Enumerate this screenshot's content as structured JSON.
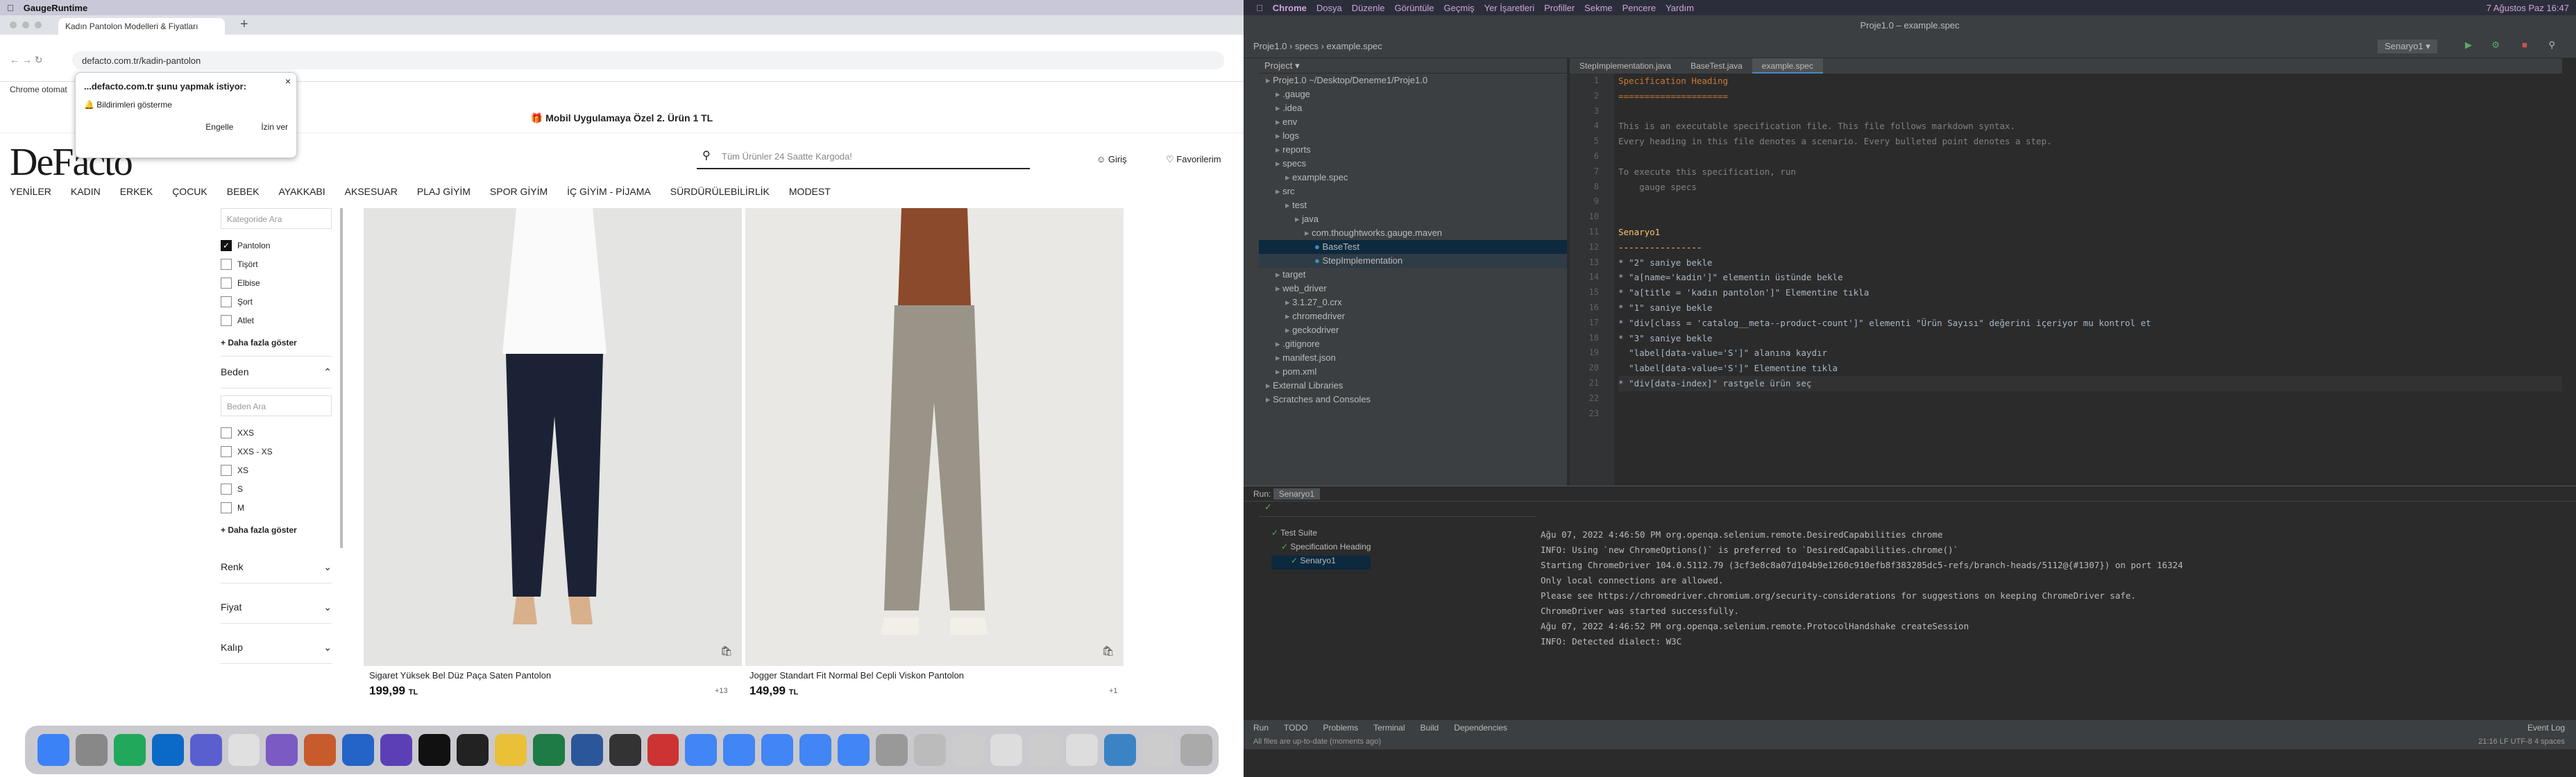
{
  "mac_left": {
    "app": "GaugeRuntime"
  },
  "mac_right": {
    "app": "Chrome",
    "menus": [
      "Dosya",
      "Düzenle",
      "Görüntüle",
      "Geçmiş",
      "Yer İşaretleri",
      "Profiller",
      "Sekme",
      "Pencere",
      "Yardım"
    ],
    "clock": "7 Ağustos Paz 16:47"
  },
  "browser": {
    "tab_title": "Kadın Pantolon Modelleri & Fiyatları",
    "url": "defacto.com.tr/kadin-pantolon",
    "chrome_label": "Chrome otomat",
    "popup": {
      "title": "...defacto.com.tr şunu yapmak istiyor:",
      "item": "Bildirimleri gösterme",
      "block": "Engelle",
      "allow": "İzin ver"
    }
  },
  "site": {
    "banner": "Mobil Uygulamaya Özel 2. Ürün 1 TL",
    "logo": "DeFacto",
    "search_placeholder": "Tüm Ürünler 24 Saatte Kargoda!",
    "login": "Giriş",
    "favorites": "Favorilerim",
    "nav": [
      "YENİLER",
      "KADIN",
      "ERKEK",
      "ÇOCUK",
      "BEBEK",
      "AYAKKABI",
      "AKSESUAR",
      "PLAJ GİYİM",
      "SPOR GİYİM",
      "İÇ GİYİM - PİJAMA",
      "SÜRDÜRÜLEBİLİRLİK",
      "MODEST"
    ],
    "category_search": "Kategoride Ara",
    "categories": [
      "Pantolon",
      "Tişört",
      "Elbise",
      "Şort",
      "Atlet"
    ],
    "more": "+ Daha fazla göster",
    "size_title": "Beden",
    "size_search": "Beden Ara",
    "sizes": [
      "XXS",
      "XXS - XS",
      "XS",
      "S",
      "M"
    ],
    "more2": "+ Daha fazla göster",
    "filters": [
      "Renk",
      "Fiyat",
      "Kalıp"
    ],
    "products": [
      {
        "name": "Sigaret Yüksek Bel Düz Paça Saten Pantolon",
        "price": "199,99",
        "currency": "TL",
        "badge": "+13"
      },
      {
        "name": "Jogger Standart Fit Normal Bel Cepli Viskon Pantolon",
        "price": "149,99",
        "currency": "TL",
        "badge": "+1"
      }
    ]
  },
  "ide": {
    "title": "Proje1.0 – example.spec",
    "breadcrumb": [
      "Proje1.0",
      "specs",
      "example.spec"
    ],
    "config": "Senaryo1",
    "project_label": "Project",
    "tree": [
      "Proje1.0 ~/Desktop/Deneme1/Proje1.0",
      ".gauge",
      ".idea",
      "env",
      "logs",
      "reports",
      "specs",
      "example.spec",
      "src",
      "test",
      "java",
      "com.thoughtworks.gauge.maven",
      "BaseTest",
      "StepImplementation",
      "target",
      "web_driver",
      "3.1.27_0.crx",
      "chromedriver",
      "geckodriver",
      ".gitignore",
      "manifest.json",
      "pom.xml",
      "External Libraries",
      "Scratches and Consoles"
    ],
    "tabs": [
      "StepImplementation.java",
      "BaseTest.java",
      "example.spec"
    ],
    "code": [
      "Specification Heading",
      "=====================",
      "",
      "This is an executable specification file. This file follows markdown syntax.",
      "Every heading in this file denotes a scenario. Every bulleted point denotes a step.",
      "",
      "To execute this specification, run",
      "    gauge specs",
      "",
      "",
      "Senaryo1",
      "----------------",
      "* \"2\" saniye bekle",
      "* \"a[name='kadin']\" elementin üstünde bekle",
      "* \"a[title = 'kadın pantolon']\" Elementine tıkla",
      "* \"1\" saniye bekle",
      "* \"div[class = 'catalog__meta--product-count']\" elementi \"Ürün Sayısı\" değerini içeriyor mu kontrol et",
      "* \"3\" saniye bekle",
      "  \"label[data-value='S']\" alanına kaydır",
      "  \"label[data-value='S']\" Elementine tıkla",
      "* \"div[data-index]\" rastgele ürün seç",
      "",
      ""
    ],
    "run_label": "Run:",
    "run_config": "Senaryo1",
    "run_tree": [
      "Test Suite",
      "Specification Heading",
      "Senaryo1"
    ],
    "console": [
      "Ağu 07, 2022 4:46:50 PM org.openqa.selenium.remote.DesiredCapabilities chrome",
      "INFO: Using `new ChromeOptions()` is preferred to `DesiredCapabilities.chrome()`",
      "Starting ChromeDriver 104.0.5112.79 (3cf3e8c8a07d104b9e1260c910efb8f383285dc5-refs/branch-heads/5112@{#1307}) on port 16324",
      "Only local connections are allowed.",
      "Please see https://chromedriver.chromium.org/security-considerations for suggestions on keeping ChromeDriver safe.",
      "ChromeDriver was started successfully.",
      "Ağu 07, 2022 4:46:52 PM org.openqa.selenium.remote.ProtocolHandshake createSession",
      "INFO: Detected dialect: W3C"
    ],
    "bottom_tabs": [
      "Run",
      "TODO",
      "Problems",
      "Terminal",
      "Build",
      "Dependencies"
    ],
    "event_log": "Event Log",
    "status": "All files are up-to-date (moments ago)",
    "status_right": "21:16  LF  UTF-8  4 spaces"
  }
}
